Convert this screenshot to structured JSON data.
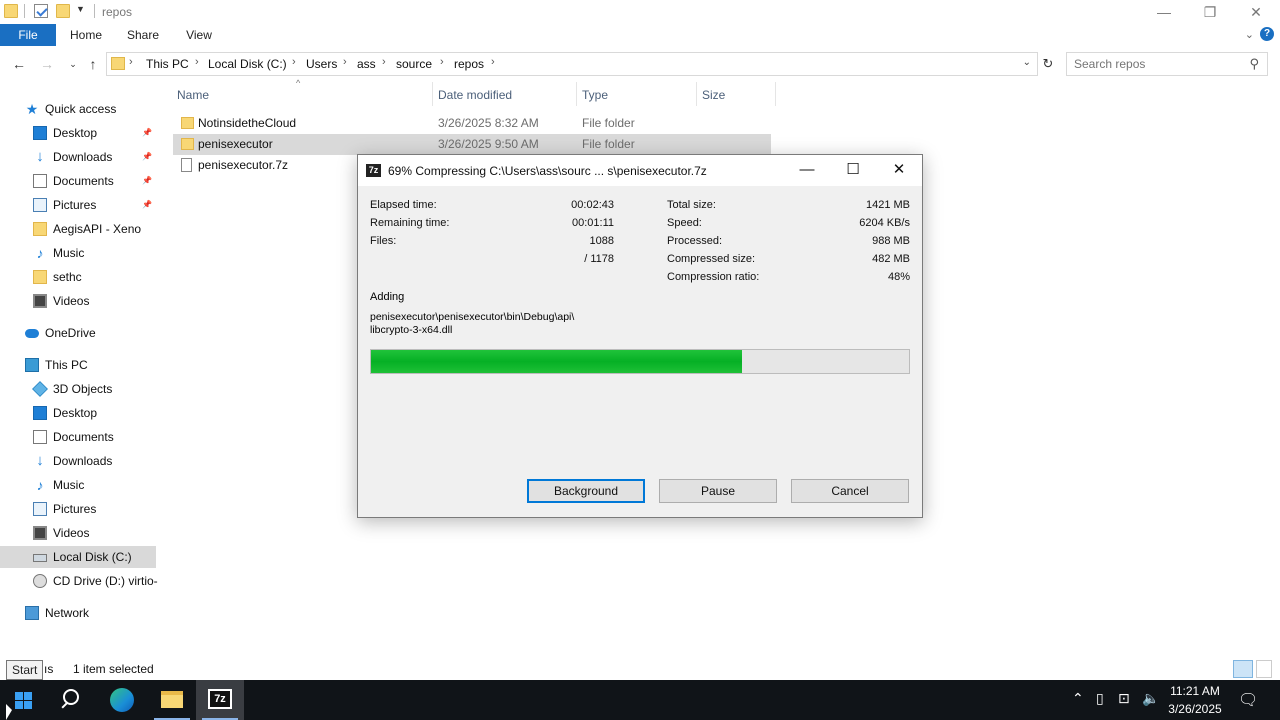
{
  "window": {
    "title": "repos",
    "controls": {
      "minimize": "—",
      "restore": "❐",
      "close": "✕"
    }
  },
  "ribbon": {
    "tabs": [
      "File",
      "Home",
      "Share",
      "View"
    ]
  },
  "address": {
    "crumbs": [
      "This PC",
      "Local Disk (C:)",
      "Users",
      "ass",
      "source",
      "repos"
    ],
    "search_placeholder": "Search repos"
  },
  "nav": {
    "items": [
      {
        "label": "Quick access",
        "icon": "star-icon"
      },
      {
        "label": "Desktop",
        "icon": "desktop-icon",
        "pinned": true
      },
      {
        "label": "Downloads",
        "icon": "download-icon",
        "pinned": true
      },
      {
        "label": "Documents",
        "icon": "documents-icon",
        "pinned": true
      },
      {
        "label": "Pictures",
        "icon": "pictures-icon",
        "pinned": true
      },
      {
        "label": "AegisAPI - Xeno",
        "icon": "folder-icon"
      },
      {
        "label": "Music",
        "icon": "music-icon"
      },
      {
        "label": "sethc",
        "icon": "folder-icon"
      },
      {
        "label": "Videos",
        "icon": "videos-icon"
      },
      {
        "label": "OneDrive",
        "icon": "cloud-icon"
      },
      {
        "label": "This PC",
        "icon": "computer-icon"
      },
      {
        "label": "3D Objects",
        "icon": "3d-objects-icon"
      },
      {
        "label": "Desktop",
        "icon": "desktop-icon"
      },
      {
        "label": "Documents",
        "icon": "documents-icon"
      },
      {
        "label": "Downloads",
        "icon": "download-icon"
      },
      {
        "label": "Music",
        "icon": "music-icon"
      },
      {
        "label": "Pictures",
        "icon": "pictures-icon"
      },
      {
        "label": "Videos",
        "icon": "videos-icon"
      },
      {
        "label": "Local Disk (C:)",
        "icon": "disk-icon",
        "selected": true
      },
      {
        "label": "CD Drive (D:) virtio-",
        "icon": "cd-drive-icon"
      },
      {
        "label": "Network",
        "icon": "network-icon"
      }
    ]
  },
  "files": {
    "columns": [
      "Name",
      "Date modified",
      "Type",
      "Size"
    ],
    "rows": [
      {
        "name": "NotinsidetheCloud",
        "date": "3/26/2025 8:32 AM",
        "type": "File folder",
        "icon": "folder-icon"
      },
      {
        "name": "penisexecutor",
        "date": "3/26/2025 9:50 AM",
        "type": "File folder",
        "icon": "folder-icon",
        "selected": true
      },
      {
        "name": "penisexecutor.7z",
        "date": "",
        "type": "",
        "icon": "file-icon"
      }
    ]
  },
  "status": {
    "tooltip": "Start",
    "items_partial": "ıs",
    "selection": "1 item selected"
  },
  "dialog": {
    "app_icon_text": "7z",
    "title": "69% Compressing C:\\Users\\ass\\sourc ... s\\penisexecutor.7z",
    "left_stats": [
      {
        "label": "Elapsed time:",
        "value": "00:02:43"
      },
      {
        "label": "Remaining time:",
        "value": "00:01:11"
      },
      {
        "label": "Files:",
        "value": "1088"
      },
      {
        "label": "",
        "value": "/ 1178"
      }
    ],
    "right_stats": [
      {
        "label": "Total size:",
        "value": "1421 MB"
      },
      {
        "label": "Speed:",
        "value": "6204 KB/s"
      },
      {
        "label": "Processed:",
        "value": "988 MB"
      },
      {
        "label": "Compressed size:",
        "value": "482 MB"
      },
      {
        "label": "Compression ratio:",
        "value": "48%"
      }
    ],
    "adding_label": "Adding",
    "adding_path_line1": "penisexecutor\\penisexecutor\\bin\\Debug\\api\\",
    "adding_path_line2": "libcrypto-3-x64.dll",
    "progress_percent": 69,
    "buttons": {
      "background": "Background",
      "pause": "Pause",
      "cancel": "Cancel"
    }
  },
  "taskbar": {
    "time": "11:21 AM",
    "date": "3/26/2025",
    "apps": [
      "start-icon",
      "search-icon",
      "edge-icon",
      "file-explorer-icon",
      "7zip-icon"
    ]
  },
  "colors": {
    "accent": "#1a6fc2",
    "progress": "#06b025",
    "taskbar": "#101418"
  }
}
